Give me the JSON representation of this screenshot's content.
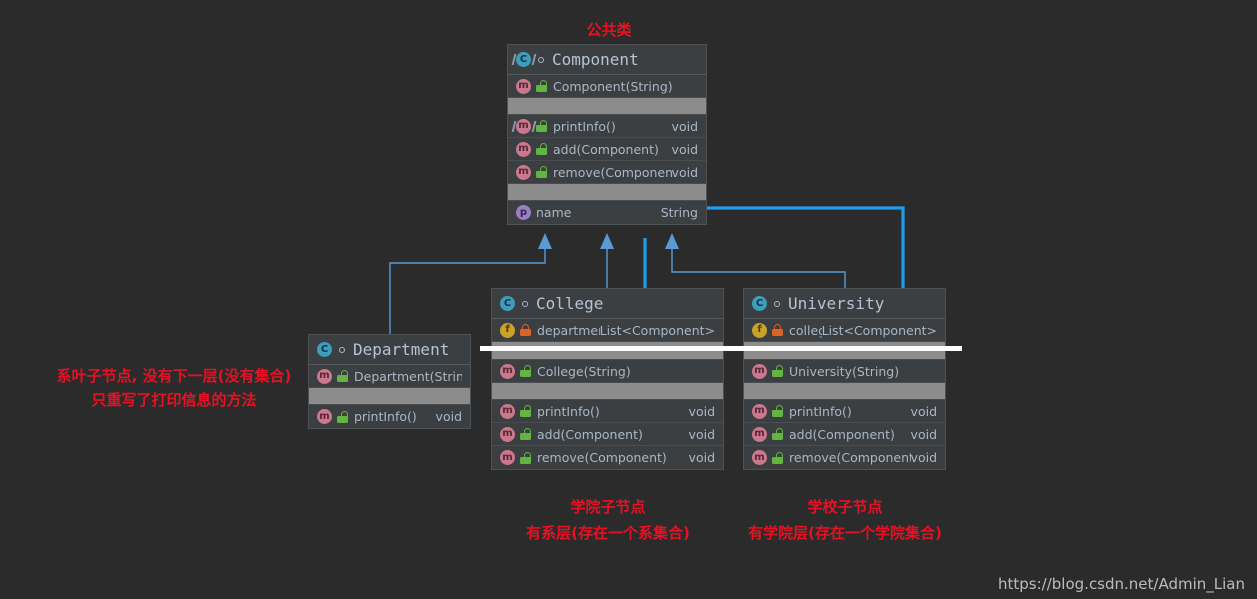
{
  "diagram": {
    "kind": "uml-class-diagram",
    "background_color": "#2b2b2b",
    "box_color": "#3c3f41",
    "inherit_arrow_color": "#5b9bd5",
    "aggregation_color": "#1d9bf0",
    "annotation_color": "#e81123"
  },
  "classes": {
    "component": {
      "name": "Component",
      "stereotype_icon": "abstract-class-icon",
      "is_abstract": true,
      "constructors": [
        {
          "name": "Component(String)",
          "visibility": "public",
          "icon": "method-icon",
          "type": ""
        }
      ],
      "methods": [
        {
          "name": "printInfo()",
          "visibility": "public",
          "icon": "abstract-method-icon",
          "type": "void"
        },
        {
          "name": "add(Component)",
          "visibility": "public",
          "icon": "method-icon",
          "type": "void"
        },
        {
          "name": "remove(Component)",
          "visibility": "public",
          "icon": "method-icon",
          "type": "void"
        }
      ],
      "properties": [
        {
          "name": "name",
          "visibility": "public",
          "icon": "property-icon",
          "type": "String"
        }
      ]
    },
    "department": {
      "name": "Department",
      "stereotype_icon": "class-icon",
      "is_abstract": false,
      "constructors": [
        {
          "name": "Department(String)",
          "visibility": "public",
          "icon": "method-icon",
          "type": ""
        }
      ],
      "methods": [
        {
          "name": "printInfo()",
          "visibility": "public",
          "icon": "method-icon",
          "type": "void"
        }
      ],
      "fields": []
    },
    "college": {
      "name": "College",
      "stereotype_icon": "class-icon",
      "is_abstract": false,
      "fields": [
        {
          "name": "departments",
          "visibility": "private",
          "icon": "field-icon",
          "type": "List<Component>"
        }
      ],
      "constructors": [
        {
          "name": "College(String)",
          "visibility": "public",
          "icon": "method-icon",
          "type": ""
        }
      ],
      "methods": [
        {
          "name": "printInfo()",
          "visibility": "public",
          "icon": "method-icon",
          "type": "void"
        },
        {
          "name": "add(Component)",
          "visibility": "public",
          "icon": "method-icon",
          "type": "void"
        },
        {
          "name": "remove(Component)",
          "visibility": "public",
          "icon": "method-icon",
          "type": "void"
        }
      ]
    },
    "university": {
      "name": "University",
      "stereotype_icon": "class-icon",
      "is_abstract": false,
      "fields": [
        {
          "name": "colleges",
          "visibility": "private",
          "icon": "field-icon",
          "type": "List<Component>"
        }
      ],
      "constructors": [
        {
          "name": "University(String)",
          "visibility": "public",
          "icon": "method-icon",
          "type": ""
        }
      ],
      "methods": [
        {
          "name": "printInfo()",
          "visibility": "public",
          "icon": "method-icon",
          "type": "void"
        },
        {
          "name": "add(Component)",
          "visibility": "public",
          "icon": "method-icon",
          "type": "void"
        },
        {
          "name": "remove(Component)",
          "visibility": "public",
          "icon": "method-icon",
          "type": "void"
        }
      ]
    }
  },
  "annotations": {
    "top": "公共类",
    "left_line1": "系叶子节点, 没有下一层(没有集合)",
    "left_line2": "只重写了打印信息的方法",
    "college_line1": "学院子节点",
    "college_line2": "有系层(存在一个系集合)",
    "university_line1": "学校子节点",
    "university_line2": "有学院层(存在一个学院集合)"
  },
  "watermark": "https://blog.csdn.net/Admin_Lian"
}
